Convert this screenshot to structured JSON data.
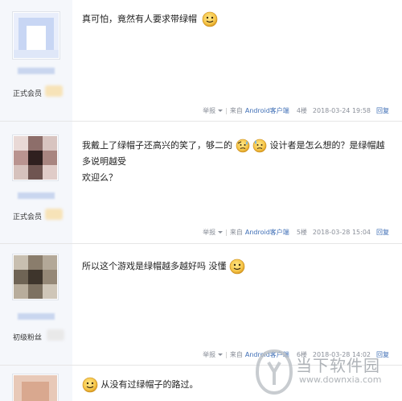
{
  "posts": [
    {
      "rank": "正式会员",
      "text": "真可怕，竟然有人要求带绿帽",
      "footer": {
        "report": "举报",
        "from_prefix": "来自",
        "source": "Android客户端",
        "floor": "4楼",
        "time": "2018-03-24 19:58",
        "reply": "回复"
      }
    },
    {
      "rank": "正式会员",
      "text_part1": "我戴上了绿帽子还高兴的笑了，够二的",
      "text_part2": "设计者是怎么想的？是绿帽越多说明越受",
      "text_part3": "欢迎么？",
      "footer": {
        "report": "举报",
        "from_prefix": "来自",
        "source": "Android客户端",
        "floor": "5楼",
        "time": "2018-03-28 15:04",
        "reply": "回复"
      }
    },
    {
      "rank": "初级粉丝",
      "text": "所以这个游戏是绿帽越多越好吗 没懂",
      "footer": {
        "report": "举报",
        "from_prefix": "来自",
        "source": "Android客户端",
        "floor": "6楼",
        "time": "2018-03-28 14:02",
        "reply": "回复"
      }
    },
    {
      "text": "从没有过绿帽子的路过。"
    }
  ],
  "watermark": {
    "title": "当下软件园",
    "url": "www.downxia.com"
  },
  "icons": {
    "emoji": "smiley-emoji-icon",
    "dropdown": "caret-down-icon",
    "logo": "downxia-logo-icon"
  },
  "colors": {
    "link": "#3d6db5",
    "sidebar": "#f5f7fb",
    "meta": "#8a8f99"
  }
}
